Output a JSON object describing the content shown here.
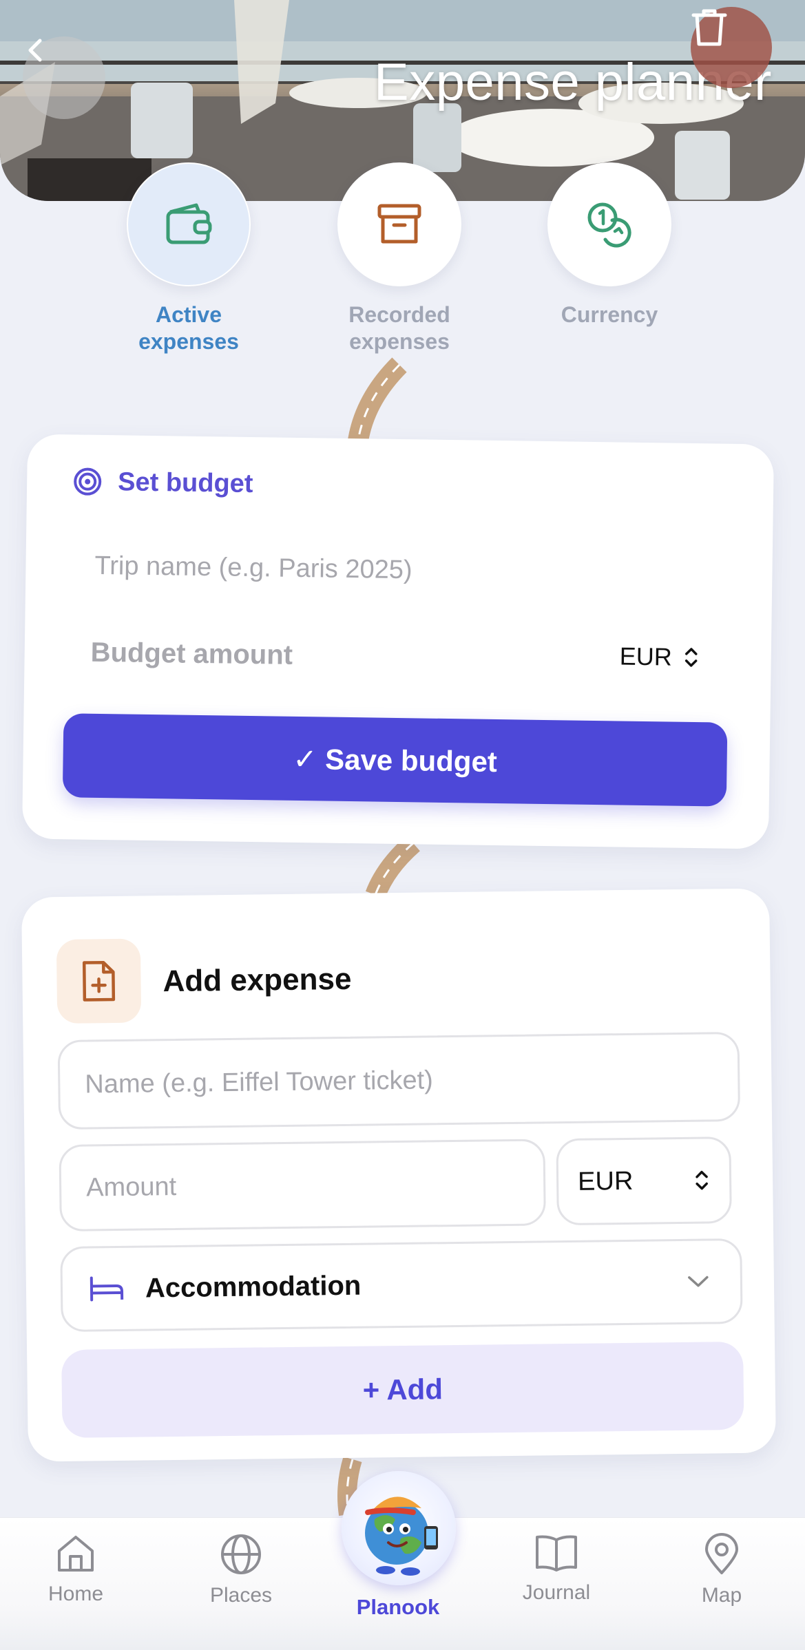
{
  "header": {
    "title": "Expense planner"
  },
  "tabs": [
    {
      "label": "Active\nexpenses",
      "line1": "Active",
      "line2": "expenses",
      "active": true,
      "icon": "wallet-icon"
    },
    {
      "label": "Recorded expenses",
      "line1": "Recorded",
      "line2": "expenses",
      "active": false,
      "icon": "archive-icon"
    },
    {
      "label": "Currency",
      "line1": "Currency",
      "line2": "",
      "active": false,
      "icon": "coins-icon"
    }
  ],
  "budget": {
    "heading": "Set budget",
    "trip_placeholder": "Trip name (e.g. Paris 2025)",
    "amount_placeholder": "Budget amount",
    "currency": "EUR",
    "save_label": "✓ Save budget"
  },
  "expense": {
    "heading": "Add expense",
    "name_placeholder": "Name (e.g. Eiffel Tower ticket)",
    "amount_placeholder": "Amount",
    "currency": "EUR",
    "category": "Accommodation",
    "add_label": "+ Add"
  },
  "nav": {
    "items": [
      {
        "label": "Home",
        "icon": "home-icon"
      },
      {
        "label": "Places",
        "icon": "globe-icon"
      },
      {
        "label": "Planook",
        "icon": "planook-mascot"
      },
      {
        "label": "Journal",
        "icon": "book-icon"
      },
      {
        "label": "Map",
        "icon": "map-pin-icon"
      }
    ]
  },
  "colors": {
    "accent": "#4d48d8",
    "active_tab": "#3f84c4",
    "background": "#eef0f7"
  }
}
